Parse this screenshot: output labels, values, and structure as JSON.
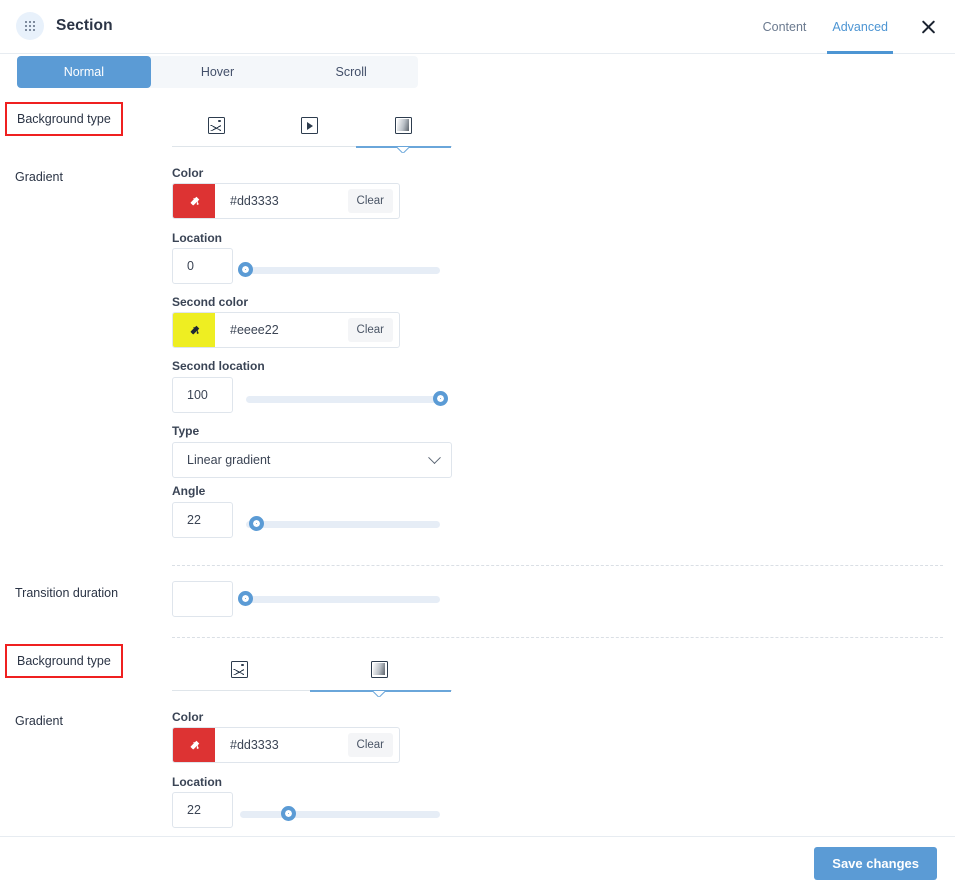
{
  "header": {
    "title": "Section",
    "drag_icon": "grid-dots-icon",
    "tabs": [
      {
        "label": "Content",
        "active": false
      },
      {
        "label": "Advanced",
        "active": true
      }
    ],
    "close_icon": "close-icon"
  },
  "state_tabs": [
    {
      "label": "Normal",
      "active": true
    },
    {
      "label": "Hover",
      "active": false
    },
    {
      "label": "Scroll",
      "active": false
    }
  ],
  "sections": {
    "normal_background": {
      "row_label": "Background type",
      "row_label_highlighted": true,
      "type_options": [
        {
          "icon": "image-icon",
          "active": false
        },
        {
          "icon": "video-icon",
          "active": false
        },
        {
          "icon": "gradient-icon",
          "active": true
        }
      ],
      "gradient_label": "Gradient",
      "color": {
        "label": "Color",
        "value": "#dd3333",
        "swatch_hex": "#dd3333",
        "swatch_icon": "eyedropper-icon",
        "clear_label": "Clear"
      },
      "location": {
        "label": "Location",
        "value": "0",
        "percent": 0
      },
      "second_color": {
        "label": "Second color",
        "value": "#eeee22",
        "swatch_hex": "#eeee22",
        "swatch_icon": "eyedropper-icon",
        "clear_label": "Clear"
      },
      "second_location": {
        "label": "Second location",
        "value": "100",
        "percent": 100
      },
      "type": {
        "label": "Type",
        "value": "Linear gradient",
        "chevron_icon": "chevron-down-icon"
      },
      "angle": {
        "label": "Angle",
        "value": "22",
        "percent": 6
      }
    },
    "transition": {
      "row_label": "Transition duration",
      "value": "",
      "placeholder": "",
      "percent": 0
    },
    "hover_background": {
      "row_label": "Background type",
      "row_label_highlighted": true,
      "type_options": [
        {
          "icon": "image-icon",
          "active": false
        },
        {
          "icon": "gradient-icon",
          "active": true
        }
      ],
      "gradient_label": "Gradient",
      "color": {
        "label": "Color",
        "value": "#dd3333",
        "swatch_hex": "#dd3333",
        "swatch_icon": "eyedropper-icon",
        "clear_label": "Clear"
      },
      "location": {
        "label": "Location",
        "value": "22",
        "percent": 22
      }
    }
  },
  "footer": {
    "save_label": "Save changes"
  },
  "colors": {
    "accent": "#5b9bd5",
    "highlight": "#ef2020",
    "text": "#2b3445",
    "track": "#e6edf6"
  }
}
